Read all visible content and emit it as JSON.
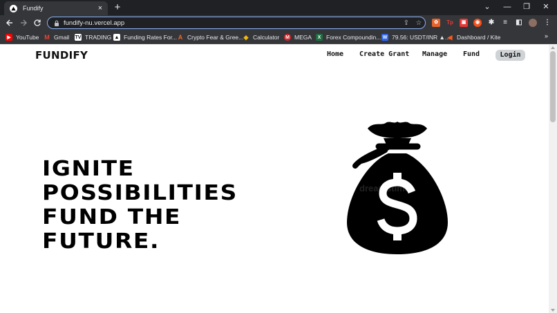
{
  "browser": {
    "tab_title": "Fundify",
    "tab_close": "×",
    "new_tab": "+",
    "url": "fundify-nu.vercel.app",
    "window_controls": [
      "⌄",
      "—",
      "❐",
      "✕"
    ]
  },
  "bookmarks": [
    {
      "label": "YouTube",
      "icon": "youtube-icon",
      "color": "#ff0000"
    },
    {
      "label": "Gmail",
      "icon": "gmail-icon",
      "color": "#ea4335"
    },
    {
      "label": "TRADING",
      "icon": "tradingview-icon",
      "color": "#131722"
    },
    {
      "label": "Funding Rates For...",
      "icon": "funding-icon",
      "color": "#000000"
    },
    {
      "label": "Crypto Fear & Gree...",
      "icon": "alternative-icon",
      "color": "#f26722"
    },
    {
      "label": "Calculator",
      "icon": "binance-icon",
      "color": "#f0b90b"
    },
    {
      "label": "MEGA",
      "icon": "mega-icon",
      "color": "#d9272e"
    },
    {
      "label": "Forex Compoundin...",
      "icon": "forex-icon",
      "color": "#1d6f42"
    },
    {
      "label": "79.56: USDT/INR ▲...",
      "icon": "wazirx-icon",
      "color": "#3067f0"
    },
    {
      "label": "Dashboard / Kite",
      "icon": "kite-icon",
      "color": "#ff5722"
    }
  ],
  "bookmarks_more": "»",
  "site": {
    "brand": "FUNDIFY",
    "nav": [
      "Home",
      "Create Grant",
      "Manage",
      "Fund"
    ],
    "login_label": "Login",
    "hero_lines": [
      "IGNITE",
      "POSSIBILITIES",
      "FUND THE",
      "FUTURE."
    ],
    "watermark": "dreamstime"
  },
  "colors": {
    "accent": "#8ab4f8",
    "chrome_dark": "#202124",
    "chrome_mid": "#35363a",
    "login_bg": "#d0d3d6"
  }
}
